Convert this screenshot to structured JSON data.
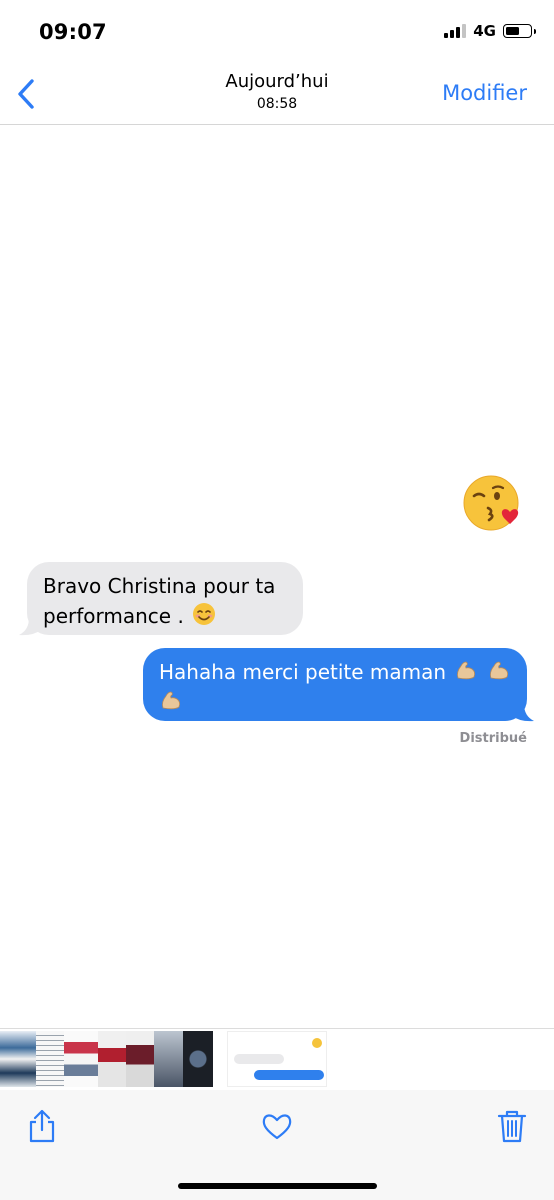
{
  "status_bar": {
    "time": "09:07",
    "network": "4G",
    "signal_bars_active": 3,
    "signal_bars_total": 4
  },
  "header": {
    "title": "Aujourd’hui",
    "subtitle": "08:58",
    "edit_label": "Modifier",
    "back_icon": "chevron-left-icon"
  },
  "messages": [
    {
      "type": "emoji",
      "direction": "incoming",
      "emoji": "😘"
    },
    {
      "type": "text",
      "direction": "incoming",
      "lines": [
        "Bravo Christina pour ta",
        "performance ."
      ],
      "emoji": "😊"
    },
    {
      "type": "text",
      "direction": "outgoing",
      "text": "Hahaha merci petite maman",
      "emoji": "💪💪💪",
      "status": "Distribué"
    }
  ],
  "thumbnail_strip": {
    "count": 8,
    "selected_index": 7
  },
  "toolbar": {
    "share_icon": "share-icon",
    "favorite_icon": "heart-icon",
    "delete_icon": "trash-icon"
  },
  "colors": {
    "accent": "#2d7cf6",
    "outgoing_bubble": "#2f80ed",
    "incoming_bubble": "#e9e9eb",
    "muted": "#8e8e93"
  }
}
